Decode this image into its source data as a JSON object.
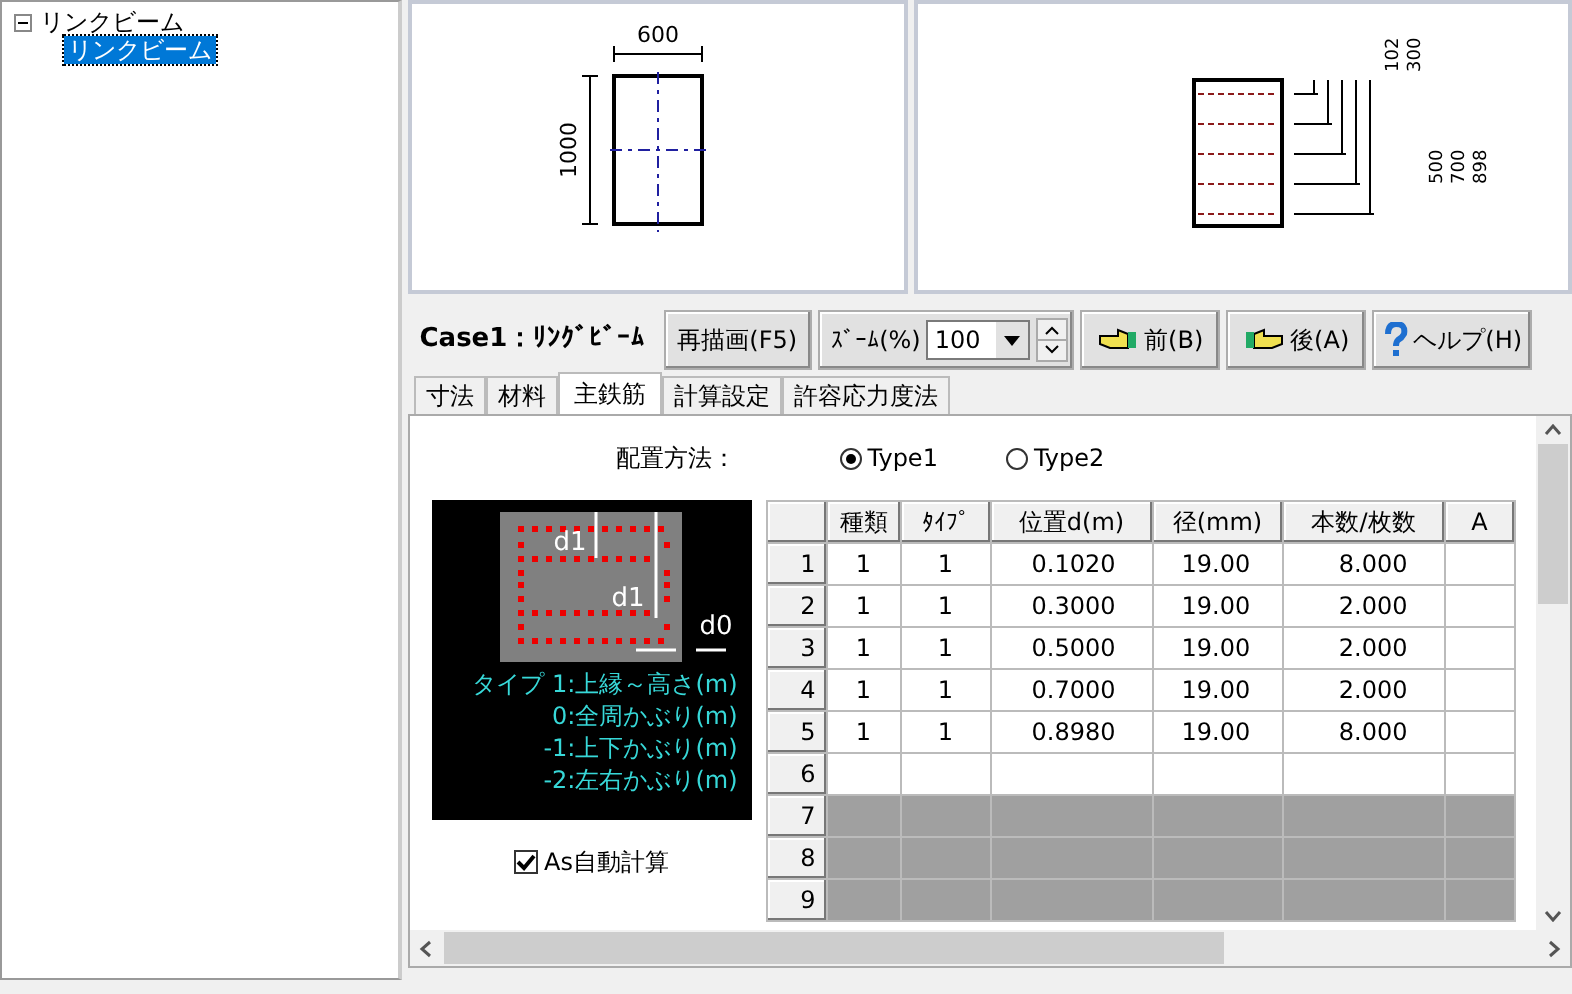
{
  "tree": [
    {
      "label": "リンクビーム",
      "expanded": true,
      "children": [
        {
          "label": "リンクビーム",
          "selected": true
        }
      ]
    }
  ],
  "section_drawing": {
    "width_dim": "600",
    "height_dim": "1000"
  },
  "rebar_drawing": {
    "dims": [
      "102",
      "300",
      "500",
      "700",
      "898"
    ]
  },
  "toolbar": {
    "case_label": "Case1：ﾘﾝｸﾞﾋﾞｰﾑ",
    "redraw_button": "再描画(F5)",
    "zoom_label": "ｽﾞｰﾑ(%)",
    "zoom_value": "100",
    "prev_button": "前(B)",
    "next_button": "後(A)",
    "help_button": "ヘルプ(H)"
  },
  "tabs": [
    {
      "label": "寸法",
      "selected": false
    },
    {
      "label": "材料",
      "selected": false
    },
    {
      "label": "主鉄筋",
      "selected": true
    },
    {
      "label": "計算設定",
      "selected": false
    },
    {
      "label": "許容応力度法",
      "selected": false
    }
  ],
  "placement": {
    "label": "配置方法：",
    "options": [
      {
        "label": "Type1",
        "selected": true
      },
      {
        "label": "Type2",
        "selected": false
      }
    ]
  },
  "legend": {
    "marks": [
      "d1",
      "d1",
      "d0"
    ],
    "lines": [
      "タイプ 1:上縁～高さ(m)",
      "0:全周かぶり(m)",
      "-1:上下かぶり(m)",
      "-2:左右かぶり(m)"
    ]
  },
  "auto_as": {
    "label": "As自動計算",
    "checked": true
  },
  "table": {
    "columns": [
      "種類",
      "ﾀｲﾌﾟ",
      "位置d(m)",
      "径(mm)",
      "本数/枚数",
      "A"
    ],
    "rows": [
      {
        "header": "1",
        "disabled": false,
        "cells": [
          "1",
          "1",
          "0.1020",
          "19.00",
          "8.000"
        ]
      },
      {
        "header": "2",
        "disabled": false,
        "cells": [
          "1",
          "1",
          "0.3000",
          "19.00",
          "2.000"
        ]
      },
      {
        "header": "3",
        "disabled": false,
        "cells": [
          "1",
          "1",
          "0.5000",
          "19.00",
          "2.000"
        ]
      },
      {
        "header": "4",
        "disabled": false,
        "cells": [
          "1",
          "1",
          "0.7000",
          "19.00",
          "2.000"
        ]
      },
      {
        "header": "5",
        "disabled": false,
        "cells": [
          "1",
          "1",
          "0.8980",
          "19.00",
          "8.000"
        ]
      },
      {
        "header": "6",
        "disabled": false
      },
      {
        "header": "7",
        "disabled": true
      },
      {
        "header": "8",
        "disabled": true
      },
      {
        "header": "9",
        "disabled": true
      }
    ]
  }
}
